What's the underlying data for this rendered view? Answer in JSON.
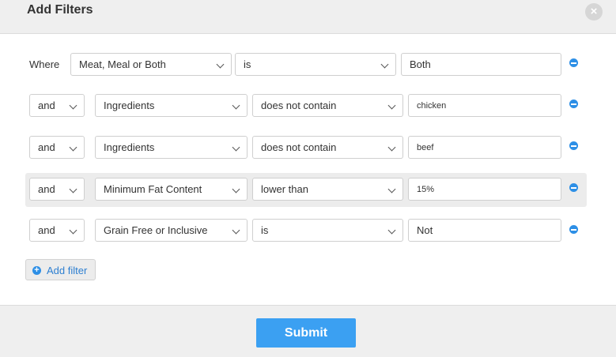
{
  "header": {
    "title": "Add Filters",
    "close_icon": "×"
  },
  "where_label": "Where",
  "filters": [
    {
      "field": "Meat, Meal or Both",
      "operator": "is",
      "value": "Both"
    },
    {
      "conjunction": "and",
      "field": "Ingredients",
      "operator": "does not contain",
      "value": "chicken"
    },
    {
      "conjunction": "and",
      "field": "Ingredients",
      "operator": "does not contain",
      "value": "beef"
    },
    {
      "conjunction": "and",
      "field": "Minimum Fat Content",
      "operator": "lower than",
      "value": "15%"
    },
    {
      "conjunction": "and",
      "field": "Grain Free or Inclusive",
      "operator": "is",
      "value": "Not"
    }
  ],
  "add_filter_label": "Add filter",
  "submit_label": "Submit",
  "colors": {
    "accent": "#3ba0f2",
    "icon_blue": "#2d8fe6"
  }
}
